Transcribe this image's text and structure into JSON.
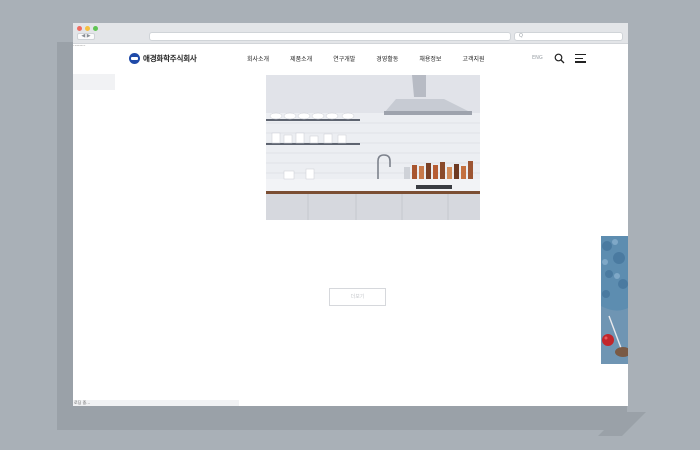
{
  "browser": {
    "address_text": "",
    "search_placeholder": "Q",
    "nav_buttons": "◀ ▶",
    "tiny_label": "samples",
    "status_text": "로딩 중..."
  },
  "header": {
    "logo_text": "애경화학주식회사",
    "nav_items": [
      "회사소개",
      "제품소개",
      "연구개발",
      "경영활동",
      "채용정보",
      "고객지원"
    ],
    "lang": "ENG"
  },
  "main": {
    "more_button_label": "더보기"
  }
}
